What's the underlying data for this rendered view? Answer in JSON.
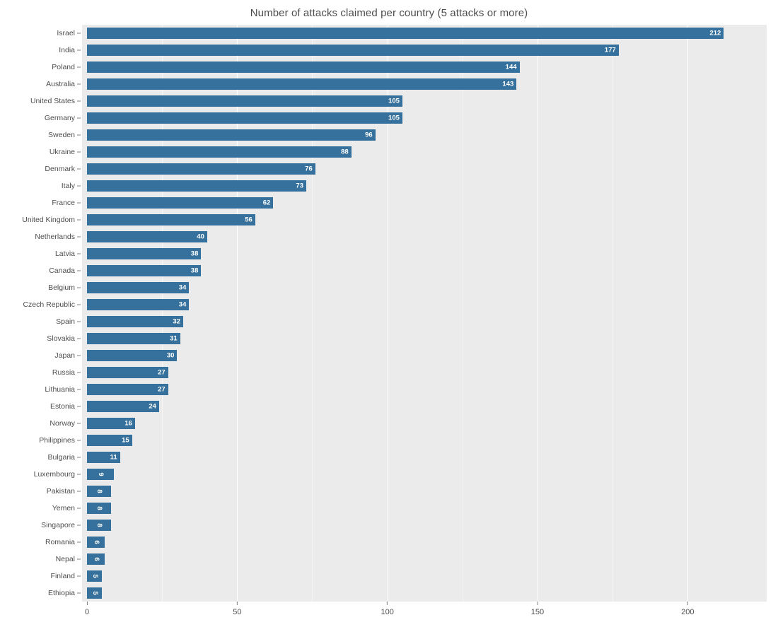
{
  "chart_data": {
    "type": "bar",
    "orientation": "horizontal",
    "title": "Number of attacks claimed per country (5 attacks or more)",
    "xlabel": "",
    "ylabel": "",
    "xlim": [
      0,
      223
    ],
    "xticks": [
      0,
      50,
      100,
      150,
      200
    ],
    "xtick_labels": [
      "0",
      "50",
      "100",
      "150",
      "200"
    ],
    "grid": true,
    "grid_axis": "x",
    "legend": "none",
    "categories": [
      "Israel",
      "India",
      "Poland",
      "Australia",
      "United States",
      "Germany",
      "Sweden",
      "Ukraine",
      "Denmark",
      "Italy",
      "France",
      "United Kingdom",
      "Netherlands",
      "Latvia",
      "Canada",
      "Belgium",
      "Czech Republic",
      "Spain",
      "Slovakia",
      "Japan",
      "Russia",
      "Lithuania",
      "Estonia",
      "Norway",
      "Philippines",
      "Bulgaria",
      "Luxembourg",
      "Pakistan",
      "Yemen",
      "Singapore",
      "Romania",
      "Nepal",
      "Finland",
      "Ethiopia"
    ],
    "values": [
      212,
      177,
      144,
      143,
      105,
      105,
      96,
      88,
      76,
      73,
      62,
      56,
      40,
      38,
      38,
      34,
      34,
      32,
      31,
      30,
      27,
      27,
      24,
      16,
      15,
      11,
      9,
      8,
      8,
      8,
      6,
      6,
      5,
      5
    ],
    "data_labels": [
      "212",
      "177",
      "144",
      "143",
      "105",
      "105",
      "96",
      "88",
      "76",
      "73",
      "62",
      "56",
      "40",
      "38",
      "38",
      "34",
      "34",
      "32",
      "31",
      "30",
      "27",
      "27",
      "24",
      "16",
      "15",
      "11",
      "9",
      "8",
      "8",
      "8",
      "6",
      "6",
      "5",
      "5"
    ],
    "bar_color": "#35719c",
    "bar_label_color": "#ffffff",
    "panel_background": "#ebebeb",
    "gridline_color": "#ffffff",
    "text_color": "#4d4d4d"
  }
}
